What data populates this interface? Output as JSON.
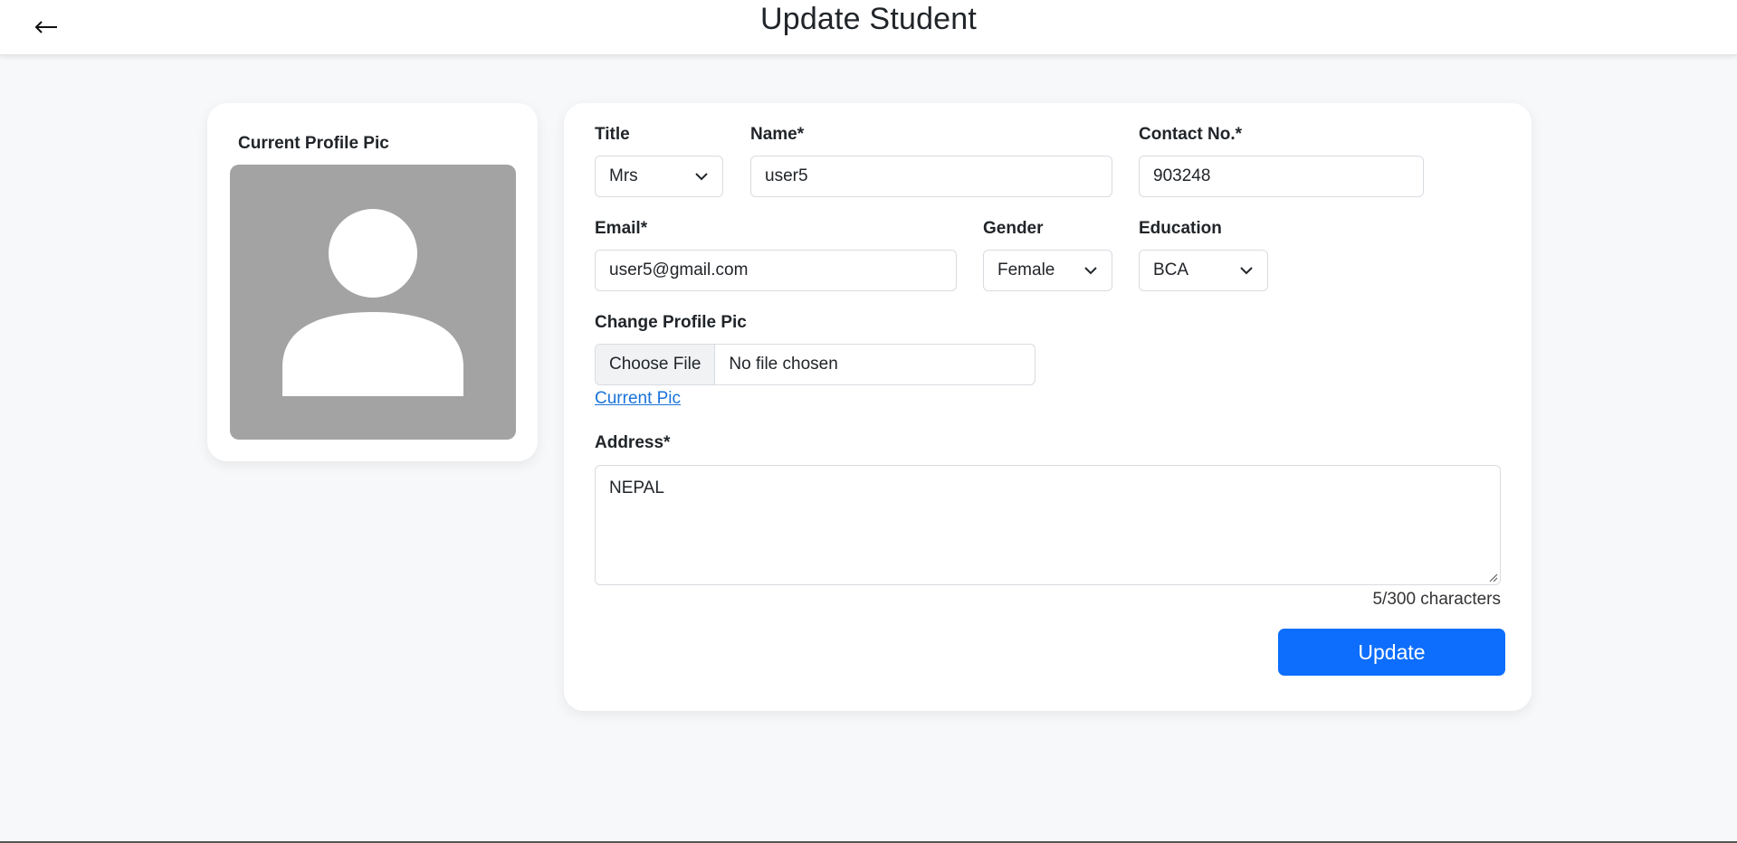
{
  "header": {
    "back_icon": "arrow-left-icon",
    "title": "Update Student"
  },
  "profile": {
    "title": "Current Profile Pic",
    "avatar_icon": "user-silhouette-icon",
    "avatar_color": "#a3a3a3"
  },
  "form": {
    "title": {
      "label": "Title",
      "value": "Mrs"
    },
    "name": {
      "label": "Name*",
      "value": "user5"
    },
    "contact": {
      "label": "Contact No.*",
      "value": "903248"
    },
    "email": {
      "label": "Email*",
      "value": "user5@gmail.com"
    },
    "gender": {
      "label": "Gender",
      "value": "Female"
    },
    "education": {
      "label": "Education",
      "value": "BCA"
    },
    "profile_pic": {
      "label": "Change Profile Pic",
      "button": "Choose File",
      "status": "No file chosen",
      "link": "Current Pic"
    },
    "address": {
      "label": "Address*",
      "value": "NEPAL",
      "counter": "5/300 characters"
    },
    "update_button": "Update"
  },
  "colors": {
    "accent": "#0d6efd",
    "link": "#1a73d9",
    "background": "#f7f8fa"
  }
}
